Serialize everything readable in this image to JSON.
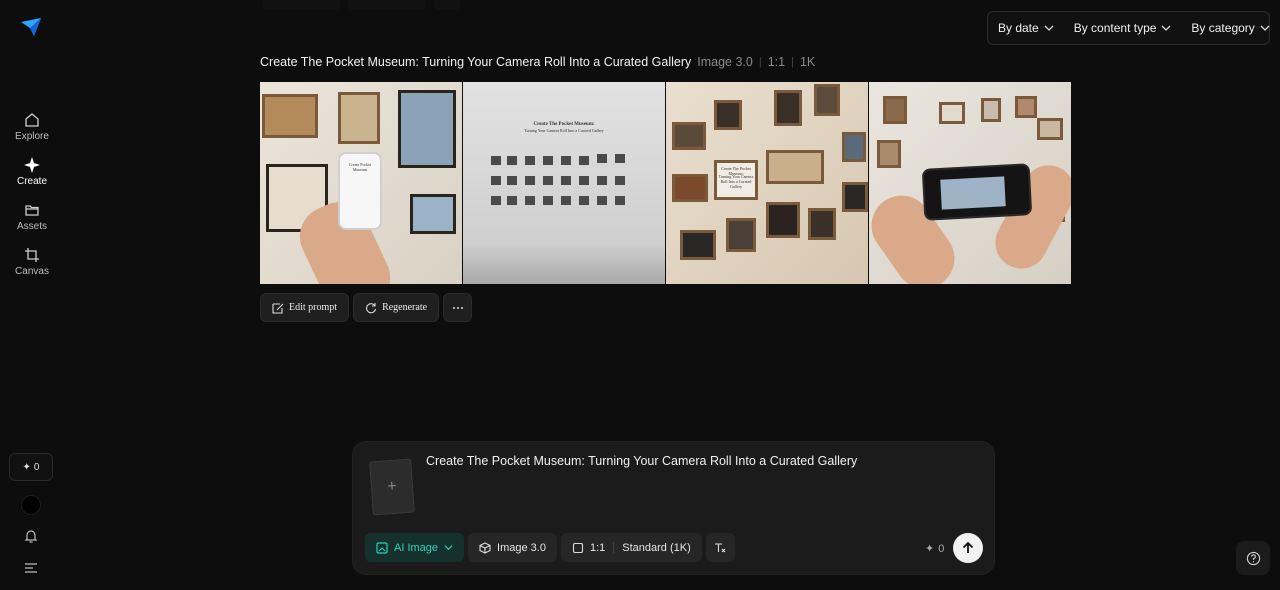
{
  "sidebar": {
    "items": [
      {
        "label": "Explore",
        "icon": "home-icon"
      },
      {
        "label": "Create",
        "icon": "sparkle-icon"
      },
      {
        "label": "Assets",
        "icon": "folder-icon"
      },
      {
        "label": "Canvas",
        "icon": "crop-icon"
      }
    ],
    "credits": "0"
  },
  "filters": {
    "by_date": "By date",
    "by_content_type": "By content type",
    "by_category": "By category"
  },
  "result": {
    "title": "Create The Pocket Museum: Turning Your Camera Roll Into a Curated Gallery",
    "model": "Image 3.0",
    "ratio": "1:1",
    "resolution": "1K",
    "wall_text_title": "Create The Pocket Museum:",
    "wall_text_sub": "Turning Your Camera Roll Into a Curated Gallery",
    "phone_screen_title": "Create Pocket Museum",
    "frame_caption_title": "Create The Pocket Museum:",
    "frame_caption_sub": "Turning Your Camera Roll Into a Curated Gallery"
  },
  "actions": {
    "edit_prompt": "Edit prompt",
    "regenerate": "Regenerate"
  },
  "composer": {
    "prompt": "Create The Pocket Museum: Turning Your Camera Roll Into a Curated Gallery",
    "mode": "AI Image",
    "model": "Image 3.0",
    "ratio": "1:1",
    "quality": "Standard (1K)",
    "cost": "0"
  },
  "colors": {
    "accent": "#2ad3b8",
    "background": "#0d0d0d"
  }
}
